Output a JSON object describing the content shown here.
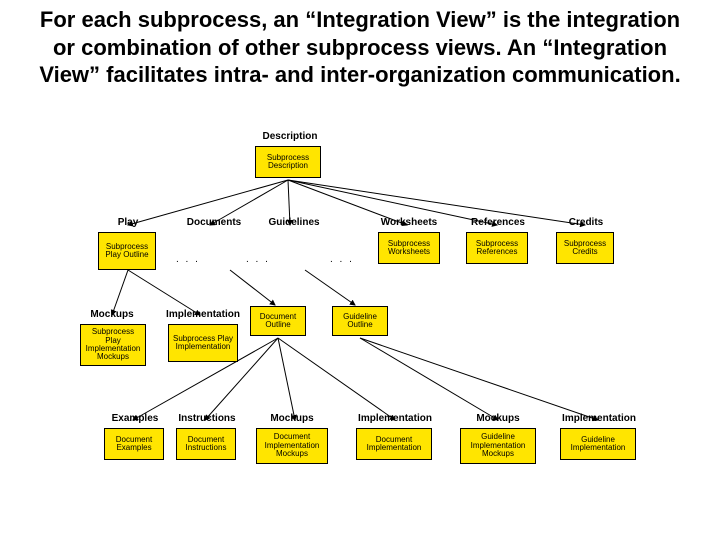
{
  "title": "For each subprocess, an “Integration View” is the integration or combination of other subprocess views. An “Integration View” facilitates intra- and inter-organization communication.",
  "labels": {
    "description": "Description",
    "play": "Play",
    "documents": "Documents",
    "guidelines": "Guidelines",
    "worksheets": "Worksheets",
    "references": "References",
    "credits": "Credits",
    "mockups": "Mockups",
    "implementation": "Implementation",
    "examples": "Examples",
    "instructions": "Instructions",
    "mockups2": "Mockups",
    "implementation2": "Implementation",
    "mockups3": "Mockups",
    "implementation3": "Implementation"
  },
  "nodes": {
    "subprocess_description": "Subprocess\nDescription",
    "subprocess_play_outline": "Subprocess\nPlay\nOutline",
    "subprocess_worksheets": "Subprocess\nWorksheets",
    "subprocess_references": "Subprocess\nReferences",
    "subprocess_credits": "Subprocess\nCredits",
    "subprocess_play_impl_mockups": "Subprocess\nPlay\nImplementation\nMockups",
    "subprocess_play_implementation": "Subprocess\nPlay\nImplementation",
    "document_outline": "Document\nOutline",
    "guideline_outline": "Guideline\nOutline",
    "document_examples": "Document\nExamples",
    "document_instructions": "Document\nInstructions",
    "document_impl_mockups": "Document\nImplementation\nMockups",
    "document_implementation": "Document\nImplementation",
    "guideline_impl_mockups": "Guideline\nImplementation\nMockups",
    "guideline_implementation": "Guideline\nImplementation"
  },
  "ellipsis": ". . ."
}
